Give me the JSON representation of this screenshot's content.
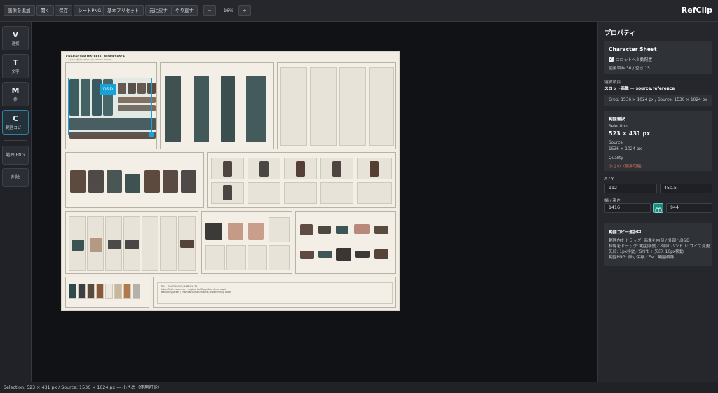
{
  "toolbar": {
    "add_image": "画像を追加",
    "open": "開く",
    "save": "保存",
    "sheet_png": "シートPNG",
    "basic_preset": "基本プリセット",
    "undo": "元に戻す",
    "redo": "やり直す",
    "zoom_out": "−",
    "zoom_level": "16%",
    "zoom_in": "+"
  },
  "app_title": "RefClip",
  "tools": [
    {
      "key": "V",
      "label": "選択"
    },
    {
      "key": "T",
      "label": "文字"
    },
    {
      "key": "M",
      "label": "枠"
    },
    {
      "key": "C",
      "label": "範囲コピー"
    }
  ],
  "actions": {
    "range_png": "範囲 PNG",
    "delete": "削除"
  },
  "sheet": {
    "title": "CHARACTER MATERIAL WORKSPACE",
    "subtitle": "キャラクター素材ワークスペース / ORIGINAL DESIGN",
    "selection_label": "D&D",
    "notes": [
      "ZEN – SOLID SMILE / APPROX. 38",
      "Urban field researcher – original RefClip public demo asset",
      "Teal utility jacket / charcoal cargo trousers / brown hiking boots"
    ],
    "swatches": [
      "#2f4a4a",
      "#3b3f44",
      "#5a4a3c",
      "#8a5a38",
      "#ece7dc",
      "#c9b79b",
      "#b27a4a",
      "#b4b1ab"
    ]
  },
  "properties": {
    "header": "プロパティ",
    "sheet_name": "Character Sheet",
    "auto_layout_label": "スロットへ自動配置",
    "auto_layout_checked": true,
    "usage": "使用済み 36 / 空き 15",
    "selected_item_label": "選択項目",
    "selected_item_value": "スロット画像 — source.reference",
    "crop_source": "Crop: 1536 × 1024 px / Source: 1536 × 1024 px",
    "range_header": "範囲選択",
    "selection_label": "Selection",
    "selection_value": "523 × 431 px",
    "source_label": "Source",
    "source_value": "1536 × 1024 px",
    "quality_label": "Quality",
    "quality_value": "小さめ（使用可能）",
    "xy_label": "X / Y",
    "x": "112",
    "y": "450.5",
    "wh_label": "幅 / 高さ",
    "w": "1416",
    "h": "944",
    "link_icon": "chain-link-icon",
    "copy_header": "範囲コピー選択中",
    "copy_help": [
      "範囲内をドラッグ: 画像を内部 / 外部へD&D",
      "枠線をドラッグ: 範囲移動／8個のハンドル: サイズ変更",
      "矢印: 1px移動／Shift + 矢印: 10px移動",
      "範囲PNG: 原寸保存／Esc: 範囲解除"
    ]
  },
  "status": "Selection: 523 × 431 px / Source: 1536 × 1024 px — 小さめ（使用可能）",
  "colors": {
    "accent": "#18a3d8",
    "quality_warning": "#e0725e",
    "link_button": "#1d8a80"
  }
}
